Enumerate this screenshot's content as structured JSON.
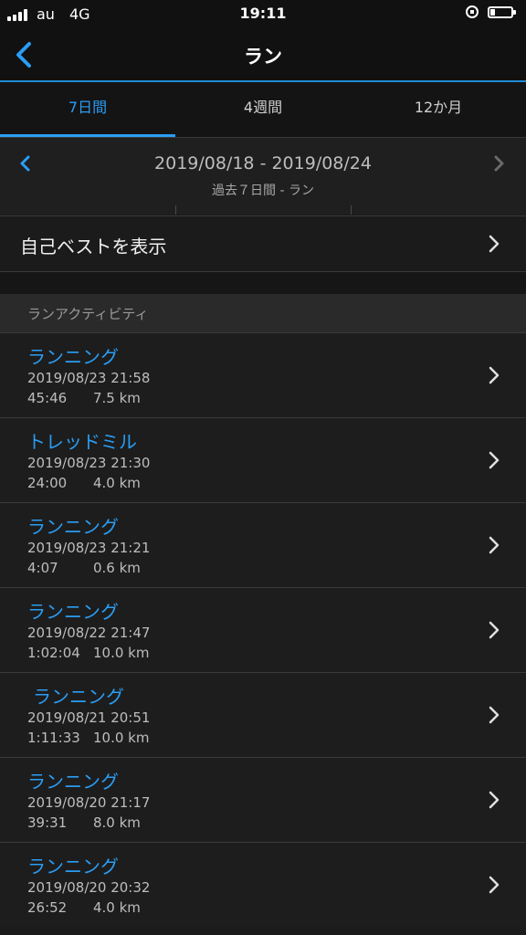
{
  "status": {
    "carrier": "au",
    "network": "4G",
    "time": "19:11"
  },
  "nav": {
    "title": "ラン"
  },
  "tabs": [
    {
      "label": "7日間",
      "active": true
    },
    {
      "label": "4週間",
      "active": false
    },
    {
      "label": "12か月",
      "active": false
    }
  ],
  "date": {
    "range": "2019/08/18 - 2019/08/24",
    "subtitle": "過去７日間 - ラン"
  },
  "personal_best": {
    "label": "自己ベストを表示"
  },
  "section": {
    "header": "ランアクティビティ"
  },
  "activities": [
    {
      "name": "ランニング",
      "datetime": "2019/08/23 21:58",
      "duration": "45:46",
      "distance": "7.5 km"
    },
    {
      "name": "トレッドミル",
      "datetime": "2019/08/23 21:30",
      "duration": "24:00",
      "distance": "4.0 km"
    },
    {
      "name": "ランニング",
      "datetime": "2019/08/23 21:21",
      "duration": "4:07",
      "distance": "0.6 km"
    },
    {
      "name": "ランニング",
      "datetime": "2019/08/22 21:47",
      "duration": "1:02:04",
      "distance": "10.0 km"
    },
    {
      "name": "ランニング",
      "datetime": "2019/08/21 20:51",
      "duration": "1:11:33",
      "distance": "10.0 km"
    },
    {
      "name": "ランニング",
      "datetime": "2019/08/20 21:17",
      "duration": "39:31",
      "distance": "8.0 km"
    },
    {
      "name": "ランニング",
      "datetime": "2019/08/20 20:32",
      "duration": "26:52",
      "distance": "4.0 km"
    }
  ],
  "colors": {
    "accent": "#2a9df4",
    "background": "#1b1b1b"
  }
}
